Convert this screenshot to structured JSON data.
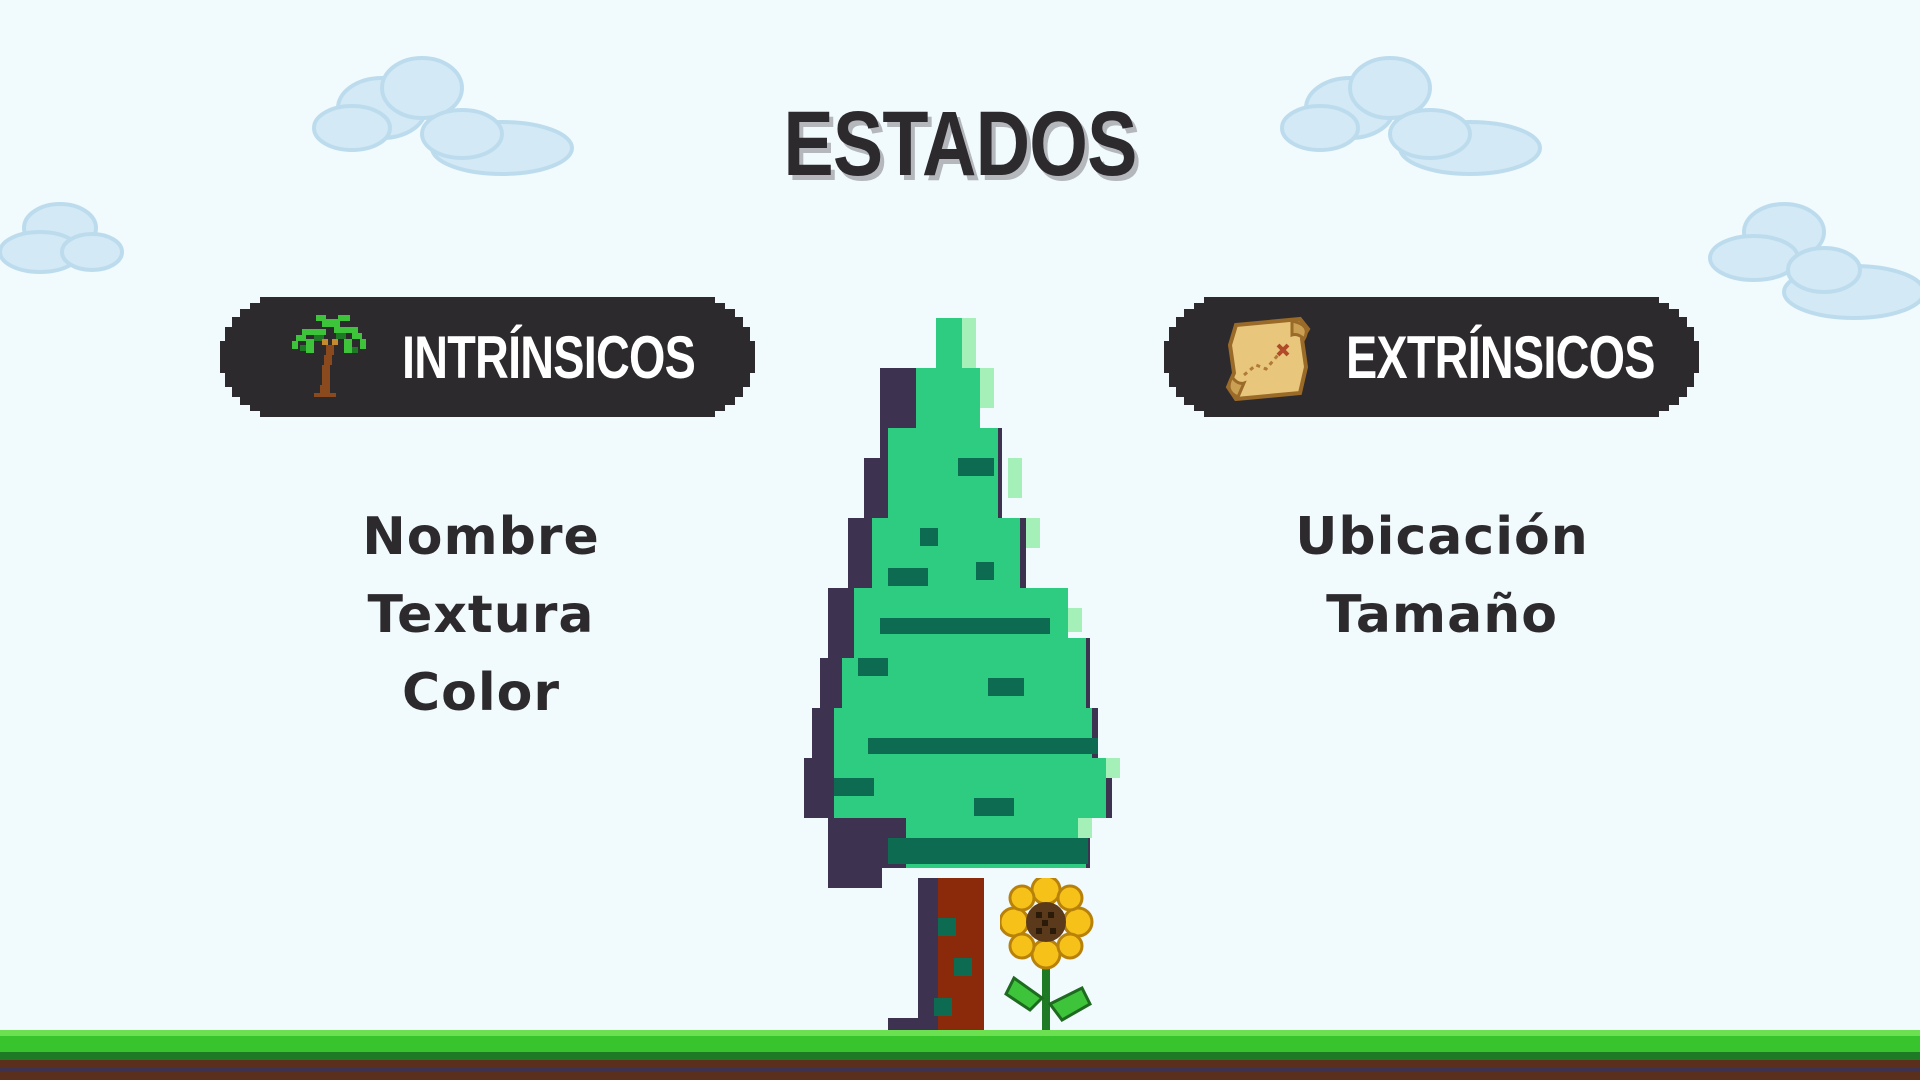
{
  "slide": {
    "title": "ESTADOS"
  },
  "intrinsic": {
    "label": "INTRÍNSICOS",
    "icon": "palm-tree-icon",
    "items": [
      "Nombre",
      "Textura",
      "Color"
    ]
  },
  "extrinsic": {
    "label": "EXTRÍNSICOS",
    "icon": "treasure-map-scroll-icon",
    "items": [
      "Ubicación",
      "Tamaño"
    ]
  },
  "colors": {
    "background": "#f1fafd",
    "text": "#2d2a2e",
    "pill": "#2d2a2e",
    "pill_text": "#ffffff",
    "cloud": "#cfe6f3",
    "tree_light": "#2ecc80",
    "tree_dark": "#0c6b50",
    "trunk": "#8a2a0a",
    "grass": "#37c42c",
    "soil": "#5a2f1c"
  }
}
